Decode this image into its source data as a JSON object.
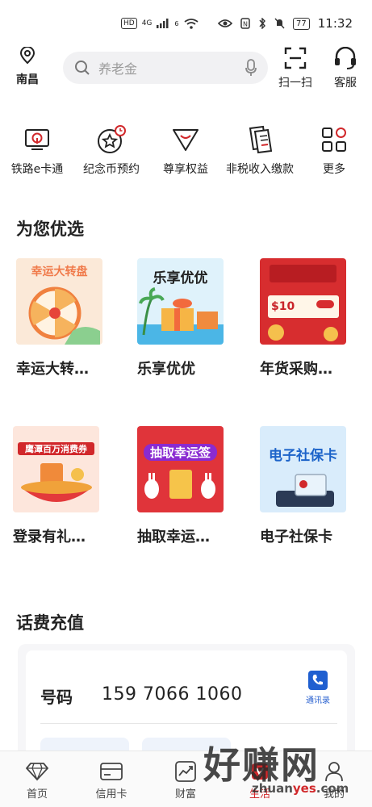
{
  "status_bar": {
    "hd": "HD",
    "net": "4G",
    "wifi_level": "6",
    "battery": "77",
    "time": "11:32"
  },
  "header": {
    "location": "南昌",
    "search_placeholder": "养老金",
    "scan_label": "扫一扫",
    "service_label": "客服"
  },
  "shortcuts": [
    {
      "label": "铁路e卡通",
      "icon": "railway-card-icon"
    },
    {
      "label": "纪念币预约",
      "icon": "coin-star-icon"
    },
    {
      "label": "尊享权益",
      "icon": "diamond-smile-icon"
    },
    {
      "label": "非税收入缴款",
      "icon": "tax-doc-icon"
    },
    {
      "label": "更多",
      "icon": "grid-more-icon"
    }
  ],
  "recommend": {
    "title": "为您优选",
    "items": [
      {
        "title": "幸运大转…",
        "thumb_text": "幸运大转盘",
        "thumb_color": "#f07a4a",
        "thumb_bg": "#fbe9d8"
      },
      {
        "title": "乐享优优",
        "thumb_text": "乐享优优",
        "thumb_color": "#222222",
        "thumb_bg": "#dff2fb"
      },
      {
        "title": "年货采购…",
        "thumb_text": "$10",
        "thumb_color": "#c9242a",
        "thumb_bg": "#d72d2f"
      },
      {
        "title": "登录有礼…",
        "thumb_text": "鹰潭百万消费券",
        "thumb_color": "#d1282b",
        "thumb_bg": "#fde6dc"
      },
      {
        "title": "抽取幸运…",
        "thumb_text": "抽取幸运签",
        "thumb_color": "#ffffff",
        "thumb_bg": "#e0343a"
      },
      {
        "title": "电子社保卡",
        "thumb_text": "电子社保卡",
        "thumb_color": "#1c63c9",
        "thumb_bg": "#d9ecfb"
      }
    ]
  },
  "recharge": {
    "title": "话费充值",
    "number_label": "号码",
    "number_value": "159 7066 1060",
    "contacts_label": "通讯录"
  },
  "tabbar": [
    {
      "label": "首页",
      "icon": "diamond-icon",
      "active": false
    },
    {
      "label": "信用卡",
      "icon": "card-icon",
      "active": false
    },
    {
      "label": "财富",
      "icon": "chart-up-icon",
      "active": false
    },
    {
      "label": "生活",
      "icon": "life-icon",
      "active": true
    },
    {
      "label": "我的",
      "icon": "user-icon",
      "active": false
    }
  ],
  "watermark": {
    "big": "好赚网",
    "small_prefix": "zhuan",
    "small_highlight": "yes",
    "small_suffix": ".com"
  },
  "colors": {
    "accent": "#d1282b",
    "link_blue": "#2a62d0"
  }
}
